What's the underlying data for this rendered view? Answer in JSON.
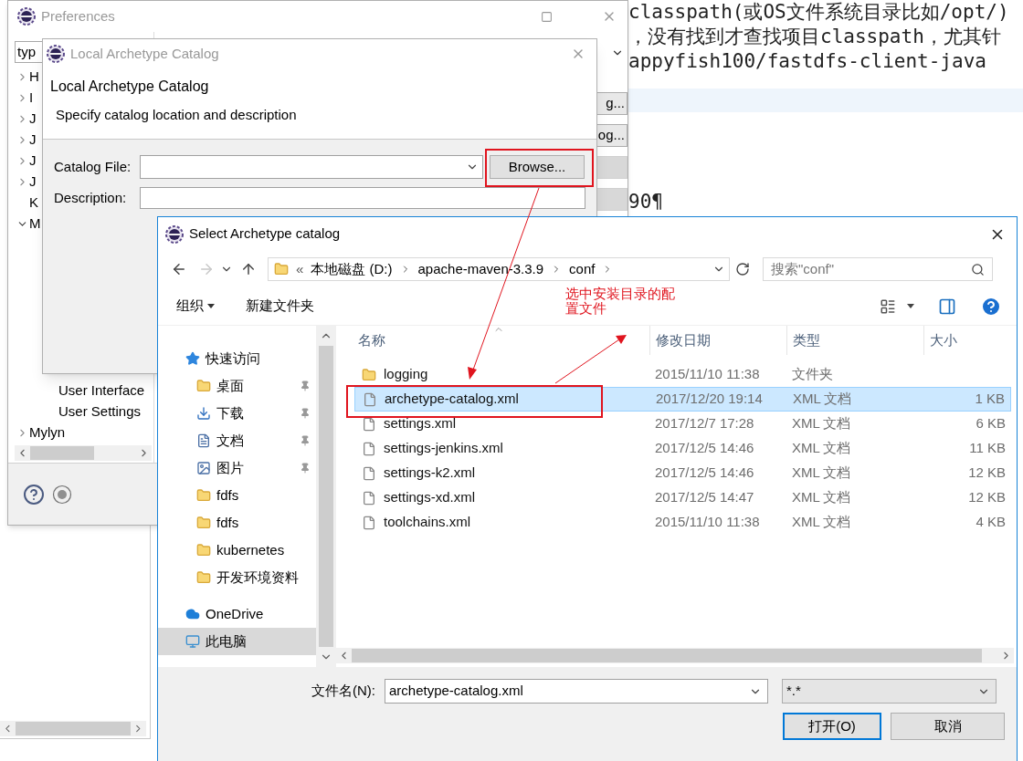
{
  "editor": {
    "lines": [
      "classpath(或OS文件系统目录比如/opt/)",
      "，没有找到才查找项目classpath，尤其针",
      "appyfish100/fastdfs-client-java"
    ],
    "tail_line": "90¶"
  },
  "preferences": {
    "title": "Preferences",
    "filter_value": "typ",
    "tree": [
      {
        "label": "H",
        "expanded": false
      },
      {
        "label": "I",
        "expanded": false
      },
      {
        "label": "J",
        "expanded": false
      },
      {
        "label": "J",
        "expanded": false
      },
      {
        "label": "J",
        "expanded": false
      },
      {
        "label": "J",
        "expanded": false
      },
      {
        "label": "K"
      },
      {
        "label": "M",
        "expanded": true,
        "children": [
          {
            "label": "User Interface"
          },
          {
            "label": "User Settings"
          }
        ]
      },
      {
        "label": "Mylyn",
        "expanded": false
      }
    ],
    "side_buttons": [
      {
        "label": "g...",
        "disabled": false
      },
      {
        "label": "og...",
        "disabled": false
      },
      {
        "disabled": true
      },
      {
        "disabled": true
      }
    ]
  },
  "local_catalog": {
    "title": "Local Archetype Catalog",
    "heading": "Local Archetype Catalog",
    "description": "Specify catalog location and description",
    "catalog_file_label": "Catalog File:",
    "browse_button": "Browse...",
    "description_label": "Description:"
  },
  "select_dialog": {
    "title": "Select Archetype catalog",
    "breadcrumbs": [
      "本地磁盘 (D:)",
      "apache-maven-3.3.9",
      "conf"
    ],
    "overflow_mark": "«",
    "search_placeholder": "搜索\"conf\"",
    "toolbar": {
      "organize": "组织",
      "new_folder": "新建文件夹"
    },
    "nav": [
      {
        "label": "快速访问",
        "kind": "star",
        "pinned": false,
        "selected": false
      },
      {
        "label": "桌面",
        "kind": "desktop",
        "pinned": true,
        "selected": false
      },
      {
        "label": "下载",
        "kind": "download",
        "pinned": true,
        "selected": false
      },
      {
        "label": "文档",
        "kind": "document",
        "pinned": true,
        "selected": false
      },
      {
        "label": "图片",
        "kind": "picture",
        "pinned": true,
        "selected": false
      },
      {
        "label": "fdfs",
        "kind": "folder",
        "pinned": false,
        "selected": false
      },
      {
        "label": "fdfs",
        "kind": "folder",
        "pinned": false,
        "selected": false
      },
      {
        "label": "kubernetes",
        "kind": "folder",
        "pinned": false,
        "selected": false
      },
      {
        "label": "开发环境资料",
        "kind": "folder",
        "pinned": false,
        "selected": false
      },
      {
        "label": "OneDrive",
        "kind": "cloud",
        "pinned": false,
        "selected": false
      },
      {
        "label": "此电脑",
        "kind": "computer",
        "pinned": false,
        "selected": true
      }
    ],
    "columns": [
      "名称",
      "修改日期",
      "类型",
      "大小"
    ],
    "files": [
      {
        "name": "logging",
        "kind": "folder",
        "modified": "2015/11/10 11:38",
        "type": "文件夹",
        "selected": false
      },
      {
        "name": "archetype-catalog.xml",
        "kind": "file",
        "modified": "2017/12/20 19:14",
        "type": "XML 文档",
        "size": "1 KB",
        "selected": true
      },
      {
        "name": "settings.xml",
        "kind": "file",
        "modified": "2017/12/7 17:28",
        "type": "XML 文档",
        "size": "6 KB",
        "selected": false
      },
      {
        "name": "settings-jenkins.xml",
        "kind": "file",
        "modified": "2017/12/5 14:46",
        "type": "XML 文档",
        "size": "11 KB",
        "selected": false
      },
      {
        "name": "settings-k2.xml",
        "kind": "file",
        "modified": "2017/12/5 14:46",
        "type": "XML 文档",
        "size": "12 KB",
        "selected": false
      },
      {
        "name": "settings-xd.xml",
        "kind": "file",
        "modified": "2017/12/5 14:47",
        "type": "XML 文档",
        "size": "12 KB",
        "selected": false
      },
      {
        "name": "toolchains.xml",
        "kind": "file",
        "modified": "2015/11/10 11:38",
        "type": "XML 文档",
        "size": "4 KB",
        "selected": false
      }
    ],
    "filename_label": "文件名(N):",
    "filename_value": "archetype-catalog.xml",
    "filter_value": "*.*",
    "open_button": "打开(O)",
    "cancel_button": "取消"
  },
  "annotation": {
    "note": "选中安装目录的配置文件"
  }
}
